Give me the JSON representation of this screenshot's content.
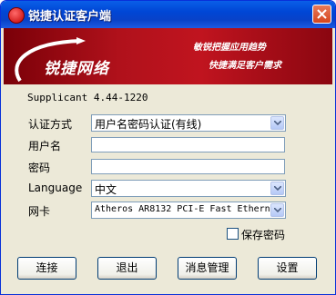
{
  "window": {
    "title": "锐捷认证客户端",
    "close_label": "×"
  },
  "banner": {
    "brand": "锐捷网络",
    "slogan1": "敏锐把握应用趋势",
    "slogan2": "快捷满足客户需求"
  },
  "form": {
    "supplicant": "Supplicant 4.44-1220",
    "auth_method_label": "认证方式",
    "auth_method_value": "用户名密码认证(有线)",
    "username_label": "用户名",
    "username_value": "",
    "password_label": "密码",
    "password_value": "",
    "language_label": "Language",
    "language_value": "中文",
    "nic_label": "网卡",
    "nic_value": "Atheros AR8132 PCI-E Fast Ethern",
    "save_password_label": "保存密码",
    "save_password_checked": false
  },
  "buttons": {
    "connect": "连接",
    "exit": "退出",
    "messages": "消息管理",
    "settings": "设置"
  },
  "colors": {
    "titlebar": "#0046d5",
    "banner": "#b0111b",
    "dialog_bg": "#ece9d8"
  }
}
